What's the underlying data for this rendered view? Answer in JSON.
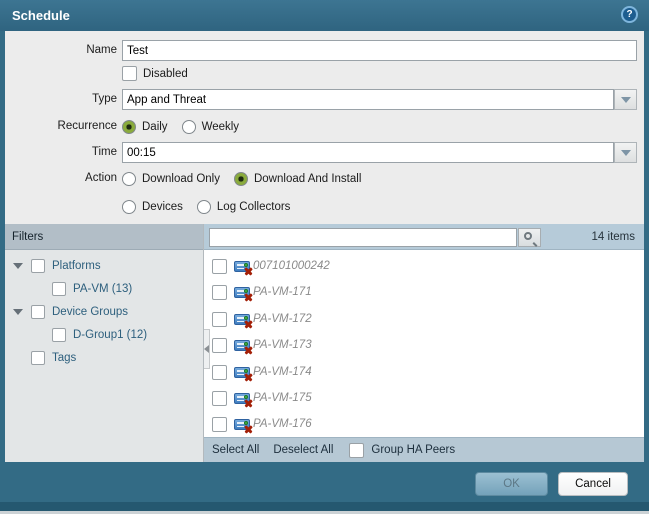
{
  "dialog": {
    "title": "Schedule"
  },
  "form": {
    "name": {
      "label": "Name",
      "value": "Test"
    },
    "disabled": {
      "label": "Disabled",
      "checked": false
    },
    "type": {
      "label": "Type",
      "value": "App and Threat"
    },
    "recurrence": {
      "label": "Recurrence",
      "options": [
        {
          "label": "Daily",
          "selected": true
        },
        {
          "label": "Weekly",
          "selected": false
        }
      ]
    },
    "time": {
      "label": "Time",
      "value": "00:15"
    },
    "action": {
      "label": "Action",
      "options": [
        {
          "label": "Download Only",
          "selected": false
        },
        {
          "label": "Download And Install",
          "selected": true
        }
      ]
    },
    "target": {
      "options": [
        {
          "label": "Devices",
          "selected": false
        },
        {
          "label": "Log Collectors",
          "selected": false
        }
      ]
    }
  },
  "filters": {
    "header": "Filters",
    "tree": [
      {
        "label": "Platforms",
        "level": 0,
        "expanded": true,
        "checked": false
      },
      {
        "label": "PA-VM (13)",
        "level": 1,
        "checked": false
      },
      {
        "label": "Device Groups",
        "level": 0,
        "expanded": true,
        "checked": false
      },
      {
        "label": "D-Group1 (12)",
        "level": 1,
        "checked": false
      },
      {
        "label": "Tags",
        "level": 0,
        "checked": false
      }
    ]
  },
  "list": {
    "search_value": "",
    "count_label": "14 items",
    "items": [
      "007101000242",
      "PA-VM-171",
      "PA-VM-172",
      "PA-VM-173",
      "PA-VM-174",
      "PA-VM-175",
      "PA-VM-176"
    ],
    "item_icon": "firewall-disconnected-icon",
    "footer": {
      "select_all": "Select All",
      "deselect_all": "Deselect All",
      "group_ha": "Group HA Peers"
    }
  },
  "buttons": {
    "ok": "OK",
    "cancel": "Cancel"
  },
  "colors": {
    "titlebar": "#336b85",
    "radio_selected": "#8aab3c",
    "header_blue": "#b6cbd9",
    "panel_gray": "#e3e6e7",
    "disconnected_x": "#a32008"
  }
}
